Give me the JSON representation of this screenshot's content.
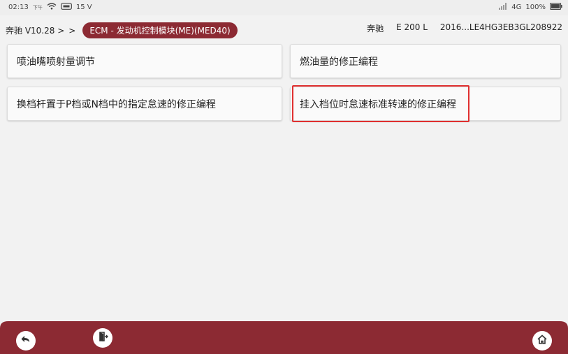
{
  "status_bar": {
    "time": "02:13",
    "am_pm": "下午",
    "voltage": "15 V",
    "network": "4G",
    "battery": "100%"
  },
  "header": {
    "app_version": "奔驰 V10.28 >",
    "separator": ">",
    "module": "ECM - 发动机控制模块(ME)(MED40)"
  },
  "vehicle": {
    "brand": "奔驰",
    "model": "E 200 L",
    "vin": "2016...LE4HG3EB3GL208922"
  },
  "functions": [
    {
      "label": "喷油嘴喷射量调节"
    },
    {
      "label": "燃油量的修正编程"
    },
    {
      "label": "换档杆置于P档或N档中的指定怠速的修正编程"
    },
    {
      "label": "挂入档位时怠速标准转速的修正编程"
    }
  ],
  "colors": {
    "accent": "#8c2a33",
    "highlight": "#e03030"
  },
  "bottom_bar": {
    "back": "back-arrow-icon",
    "exit": "exit-door-icon",
    "home": "home-icon"
  }
}
